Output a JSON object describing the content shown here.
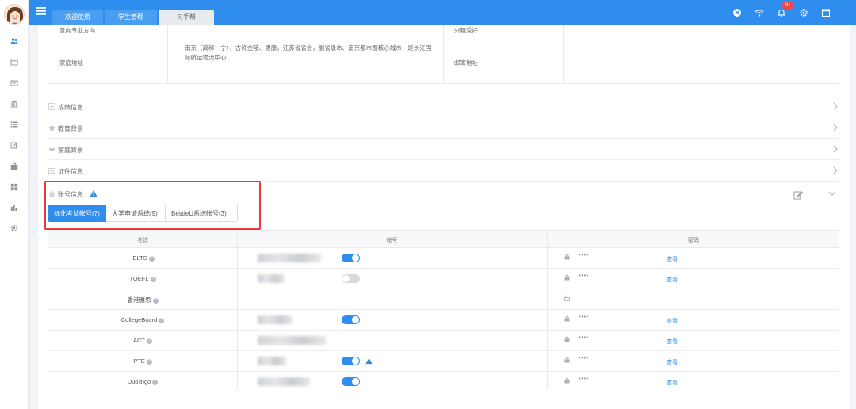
{
  "app": {
    "colors": {
      "primary": "#2e8ded",
      "highlight": "#e53c3c",
      "warning": "#2e8ded"
    }
  },
  "sidebar": {
    "icons": [
      "users-icon",
      "calendar-icon",
      "mail-icon",
      "bank-icon",
      "list-icon",
      "edit-icon",
      "briefcase-icon",
      "grid-icon",
      "chart-icon",
      "gear-icon"
    ]
  },
  "topbar": {
    "tabs": [
      {
        "label": "欢迎使用"
      },
      {
        "label": "学生管理"
      },
      {
        "label": "习手帮"
      }
    ],
    "notification_count": "9+"
  },
  "info": {
    "major_label": "意向专业方向",
    "hobby_label": "兴趣爱好",
    "address_label": "家庭地址",
    "address_value_line1": "南京（简称：宁），古称金陵、建康，江苏省省会，副省级市、南京都市圈核心城市，是长江国",
    "address_value_line2": "际航运物流中心",
    "mail_label": "邮寄地址"
  },
  "sections": [
    {
      "title": "成绩信息"
    },
    {
      "title": "教育背景"
    },
    {
      "title": "家庭背景"
    },
    {
      "title": "证件信息"
    }
  ],
  "account": {
    "title": "账号信息",
    "subtabs": [
      {
        "label": "标化考试帐号(7)"
      },
      {
        "label": "大学申请系统(9)"
      },
      {
        "label": "BestieU系统帐号(3)"
      }
    ],
    "headers": {
      "exam": "考试",
      "account": "帐号",
      "password": "密码"
    },
    "rows": [
      {
        "exam": "IELTS",
        "masked": "****",
        "view": "查看",
        "toggle_on": true
      },
      {
        "exam": "TOEFL",
        "masked": "****",
        "view": "查看",
        "toggle_on": false
      },
      {
        "exam": "香港雅思",
        "masked": "",
        "view": "",
        "toggle_on": null
      },
      {
        "exam": "CollegeBoard",
        "masked": "****",
        "view": "查看",
        "toggle_on": true
      },
      {
        "exam": "ACT",
        "masked": "****",
        "view": "查看",
        "toggle_on": null
      },
      {
        "exam": "PTE",
        "masked": "****",
        "view": "查看",
        "toggle_on": true
      },
      {
        "exam": "Duolingo",
        "masked": "****",
        "view": "查看",
        "toggle_on": true
      }
    ]
  }
}
